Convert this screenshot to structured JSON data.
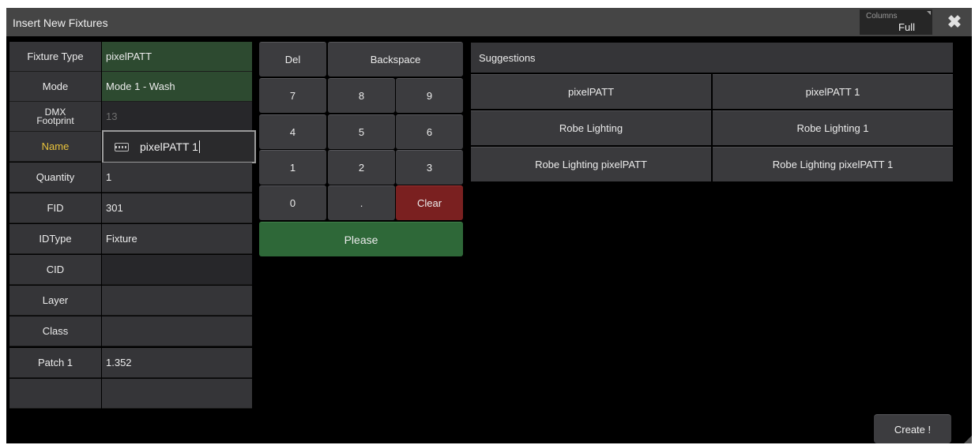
{
  "window": {
    "title": "Insert New Fixtures",
    "columns_label": "Columns",
    "columns_value": "Full",
    "close_glyph": "✖"
  },
  "properties": [
    {
      "label": "Fixture Type",
      "value": "pixelPATT"
    },
    {
      "label": "Mode",
      "value": "Mode 1 - Wash"
    },
    {
      "label_line1": "DMX",
      "label_line2": "Footprint",
      "value": "13"
    },
    {
      "label": "Name",
      "value": "pixelPATT 1"
    },
    {
      "label": "Quantity",
      "value": "1"
    },
    {
      "label": "FID",
      "value": "301"
    },
    {
      "label": "IDType",
      "value": "Fixture"
    },
    {
      "label": "CID",
      "value": ""
    },
    {
      "label": "Layer",
      "value": ""
    },
    {
      "label": "Class",
      "value": ""
    },
    {
      "label": "Patch 1",
      "value": "1.352"
    },
    {
      "label": "",
      "value": ""
    }
  ],
  "keypad": {
    "del": "Del",
    "backspace": "Backspace",
    "k7": "7",
    "k8": "8",
    "k9": "9",
    "k4": "4",
    "k5": "5",
    "k6": "6",
    "k1": "1",
    "k2": "2",
    "k3": "3",
    "k0": "0",
    "dot": ".",
    "clear": "Clear",
    "please": "Please"
  },
  "suggestions": {
    "header": "Suggestions",
    "items": [
      "pixelPATT",
      "pixelPATT 1",
      "Robe Lighting",
      "Robe Lighting 1",
      "Robe Lighting pixelPATT",
      "Robe Lighting pixelPATT 1"
    ]
  },
  "create_label": "Create !",
  "colors": {
    "title_bar": "#454545",
    "active_label": "#e8c23c",
    "green_value": "#2d4a30",
    "clear_button": "#7a2020",
    "please_button": "#2e6838"
  },
  "icons": {
    "close": "close-icon",
    "keyboard": "keyboard-icon"
  }
}
